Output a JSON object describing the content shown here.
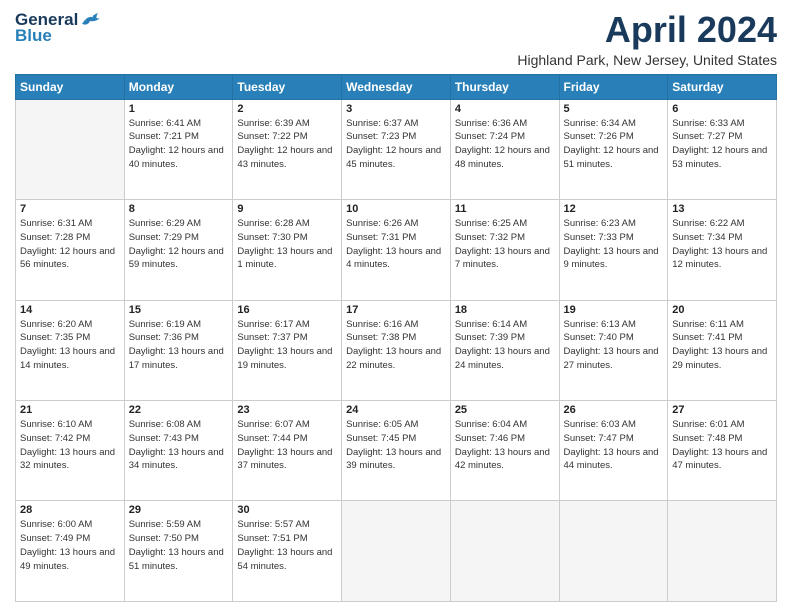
{
  "header": {
    "logo_general": "General",
    "logo_blue": "Blue",
    "month_title": "April 2024",
    "location": "Highland Park, New Jersey, United States"
  },
  "days_of_week": [
    "Sunday",
    "Monday",
    "Tuesday",
    "Wednesday",
    "Thursday",
    "Friday",
    "Saturday"
  ],
  "weeks": [
    [
      {
        "day": "",
        "empty": true
      },
      {
        "day": "1",
        "sunrise": "Sunrise: 6:41 AM",
        "sunset": "Sunset: 7:21 PM",
        "daylight": "Daylight: 12 hours and 40 minutes."
      },
      {
        "day": "2",
        "sunrise": "Sunrise: 6:39 AM",
        "sunset": "Sunset: 7:22 PM",
        "daylight": "Daylight: 12 hours and 43 minutes."
      },
      {
        "day": "3",
        "sunrise": "Sunrise: 6:37 AM",
        "sunset": "Sunset: 7:23 PM",
        "daylight": "Daylight: 12 hours and 45 minutes."
      },
      {
        "day": "4",
        "sunrise": "Sunrise: 6:36 AM",
        "sunset": "Sunset: 7:24 PM",
        "daylight": "Daylight: 12 hours and 48 minutes."
      },
      {
        "day": "5",
        "sunrise": "Sunrise: 6:34 AM",
        "sunset": "Sunset: 7:26 PM",
        "daylight": "Daylight: 12 hours and 51 minutes."
      },
      {
        "day": "6",
        "sunrise": "Sunrise: 6:33 AM",
        "sunset": "Sunset: 7:27 PM",
        "daylight": "Daylight: 12 hours and 53 minutes."
      }
    ],
    [
      {
        "day": "7",
        "sunrise": "Sunrise: 6:31 AM",
        "sunset": "Sunset: 7:28 PM",
        "daylight": "Daylight: 12 hours and 56 minutes."
      },
      {
        "day": "8",
        "sunrise": "Sunrise: 6:29 AM",
        "sunset": "Sunset: 7:29 PM",
        "daylight": "Daylight: 12 hours and 59 minutes."
      },
      {
        "day": "9",
        "sunrise": "Sunrise: 6:28 AM",
        "sunset": "Sunset: 7:30 PM",
        "daylight": "Daylight: 13 hours and 1 minute."
      },
      {
        "day": "10",
        "sunrise": "Sunrise: 6:26 AM",
        "sunset": "Sunset: 7:31 PM",
        "daylight": "Daylight: 13 hours and 4 minutes."
      },
      {
        "day": "11",
        "sunrise": "Sunrise: 6:25 AM",
        "sunset": "Sunset: 7:32 PM",
        "daylight": "Daylight: 13 hours and 7 minutes."
      },
      {
        "day": "12",
        "sunrise": "Sunrise: 6:23 AM",
        "sunset": "Sunset: 7:33 PM",
        "daylight": "Daylight: 13 hours and 9 minutes."
      },
      {
        "day": "13",
        "sunrise": "Sunrise: 6:22 AM",
        "sunset": "Sunset: 7:34 PM",
        "daylight": "Daylight: 13 hours and 12 minutes."
      }
    ],
    [
      {
        "day": "14",
        "sunrise": "Sunrise: 6:20 AM",
        "sunset": "Sunset: 7:35 PM",
        "daylight": "Daylight: 13 hours and 14 minutes."
      },
      {
        "day": "15",
        "sunrise": "Sunrise: 6:19 AM",
        "sunset": "Sunset: 7:36 PM",
        "daylight": "Daylight: 13 hours and 17 minutes."
      },
      {
        "day": "16",
        "sunrise": "Sunrise: 6:17 AM",
        "sunset": "Sunset: 7:37 PM",
        "daylight": "Daylight: 13 hours and 19 minutes."
      },
      {
        "day": "17",
        "sunrise": "Sunrise: 6:16 AM",
        "sunset": "Sunset: 7:38 PM",
        "daylight": "Daylight: 13 hours and 22 minutes."
      },
      {
        "day": "18",
        "sunrise": "Sunrise: 6:14 AM",
        "sunset": "Sunset: 7:39 PM",
        "daylight": "Daylight: 13 hours and 24 minutes."
      },
      {
        "day": "19",
        "sunrise": "Sunrise: 6:13 AM",
        "sunset": "Sunset: 7:40 PM",
        "daylight": "Daylight: 13 hours and 27 minutes."
      },
      {
        "day": "20",
        "sunrise": "Sunrise: 6:11 AM",
        "sunset": "Sunset: 7:41 PM",
        "daylight": "Daylight: 13 hours and 29 minutes."
      }
    ],
    [
      {
        "day": "21",
        "sunrise": "Sunrise: 6:10 AM",
        "sunset": "Sunset: 7:42 PM",
        "daylight": "Daylight: 13 hours and 32 minutes."
      },
      {
        "day": "22",
        "sunrise": "Sunrise: 6:08 AM",
        "sunset": "Sunset: 7:43 PM",
        "daylight": "Daylight: 13 hours and 34 minutes."
      },
      {
        "day": "23",
        "sunrise": "Sunrise: 6:07 AM",
        "sunset": "Sunset: 7:44 PM",
        "daylight": "Daylight: 13 hours and 37 minutes."
      },
      {
        "day": "24",
        "sunrise": "Sunrise: 6:05 AM",
        "sunset": "Sunset: 7:45 PM",
        "daylight": "Daylight: 13 hours and 39 minutes."
      },
      {
        "day": "25",
        "sunrise": "Sunrise: 6:04 AM",
        "sunset": "Sunset: 7:46 PM",
        "daylight": "Daylight: 13 hours and 42 minutes."
      },
      {
        "day": "26",
        "sunrise": "Sunrise: 6:03 AM",
        "sunset": "Sunset: 7:47 PM",
        "daylight": "Daylight: 13 hours and 44 minutes."
      },
      {
        "day": "27",
        "sunrise": "Sunrise: 6:01 AM",
        "sunset": "Sunset: 7:48 PM",
        "daylight": "Daylight: 13 hours and 47 minutes."
      }
    ],
    [
      {
        "day": "28",
        "sunrise": "Sunrise: 6:00 AM",
        "sunset": "Sunset: 7:49 PM",
        "daylight": "Daylight: 13 hours and 49 minutes."
      },
      {
        "day": "29",
        "sunrise": "Sunrise: 5:59 AM",
        "sunset": "Sunset: 7:50 PM",
        "daylight": "Daylight: 13 hours and 51 minutes."
      },
      {
        "day": "30",
        "sunrise": "Sunrise: 5:57 AM",
        "sunset": "Sunset: 7:51 PM",
        "daylight": "Daylight: 13 hours and 54 minutes."
      },
      {
        "day": "",
        "empty": true
      },
      {
        "day": "",
        "empty": true
      },
      {
        "day": "",
        "empty": true
      },
      {
        "day": "",
        "empty": true
      }
    ]
  ]
}
